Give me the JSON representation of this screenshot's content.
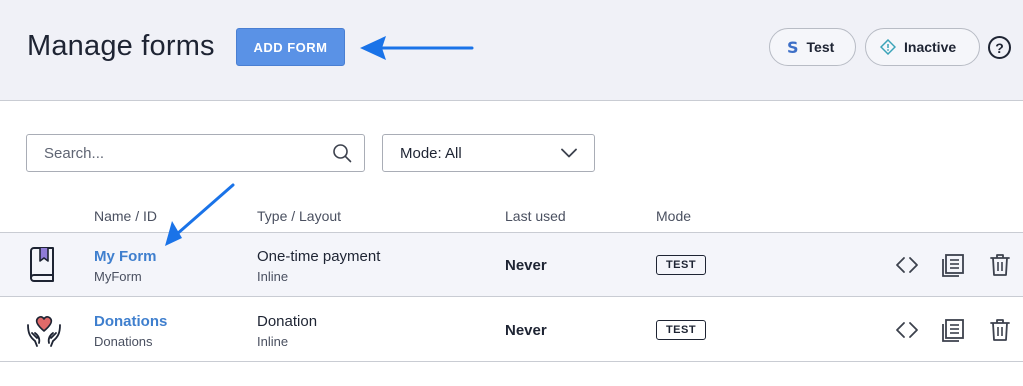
{
  "header": {
    "title": "Manage forms",
    "add_button_label": "ADD FORM",
    "pills": {
      "test_label": "Test",
      "inactive_label": "Inactive"
    },
    "help_glyph": "?"
  },
  "filters": {
    "search_placeholder": "Search...",
    "mode_select_value": "Mode: All"
  },
  "table": {
    "columns": {
      "name": "Name / ID",
      "type": "Type / Layout",
      "last_used": "Last used",
      "mode": "Mode"
    },
    "rows": [
      {
        "icon": "book-bookmark-icon",
        "name": "My Form",
        "id": "MyForm",
        "type": "One-time payment",
        "layout": "Inline",
        "last_used": "Never",
        "mode": "TEST"
      },
      {
        "icon": "heart-hands-icon",
        "name": "Donations",
        "id": "Donations",
        "type": "Donation",
        "layout": "Inline",
        "last_used": "Never",
        "mode": "TEST"
      }
    ]
  },
  "colors": {
    "accent": "#5a92e6",
    "link": "#3f7fce",
    "annotation_arrow": "#1a73e8",
    "header_bg": "#f0f1f7"
  }
}
